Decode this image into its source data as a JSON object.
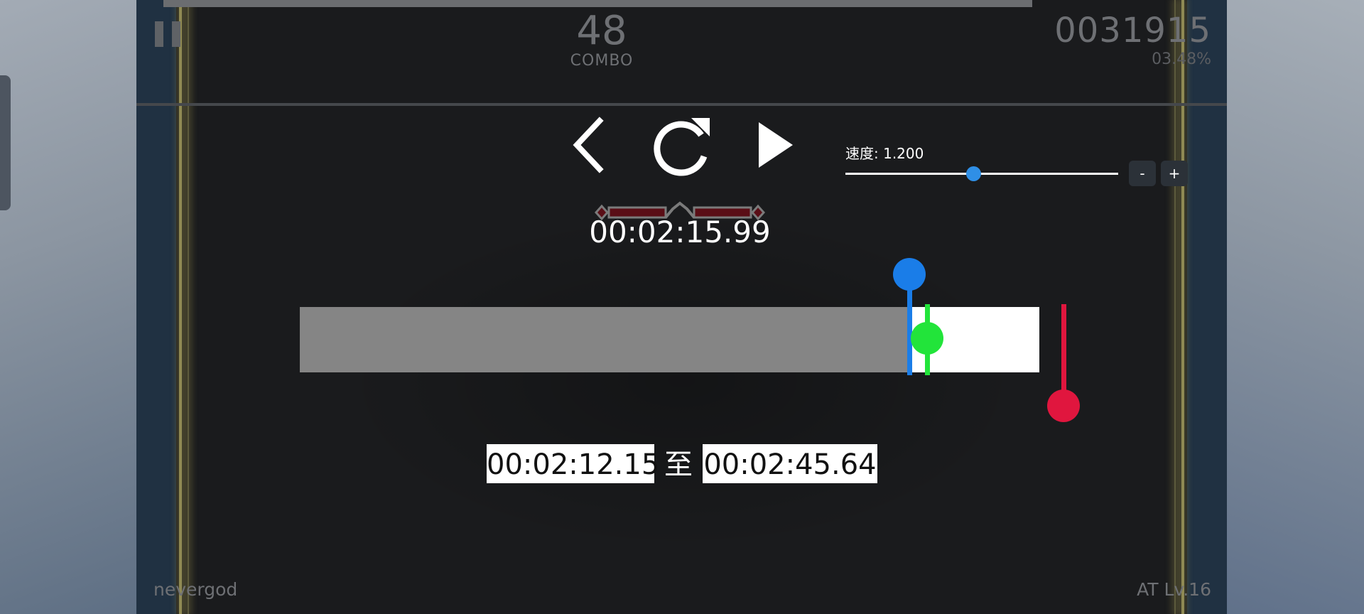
{
  "hud": {
    "combo": "48",
    "combo_label": "COMBO",
    "score": "0031915",
    "percent": "03.48%",
    "player_name": "nevergod",
    "level": "AT Lv.16"
  },
  "controls": {
    "speed_label": "速度: 1.200",
    "speed_minus": "-",
    "speed_plus": "+",
    "speed_slider_fraction": 0.47
  },
  "timeline": {
    "current_time": "00:02:15.99",
    "start_time": "00:02:12.15",
    "to_label": "至",
    "end_time": "00:02:45.64"
  },
  "colors": {
    "marker_start": "#1a7de8",
    "marker_current": "#22e43a",
    "marker_end": "#e0163e",
    "slider_thumb": "#2f8fe6"
  },
  "icons": [
    "pause-icon",
    "back-chevron-icon",
    "retry-icon",
    "play-icon"
  ]
}
